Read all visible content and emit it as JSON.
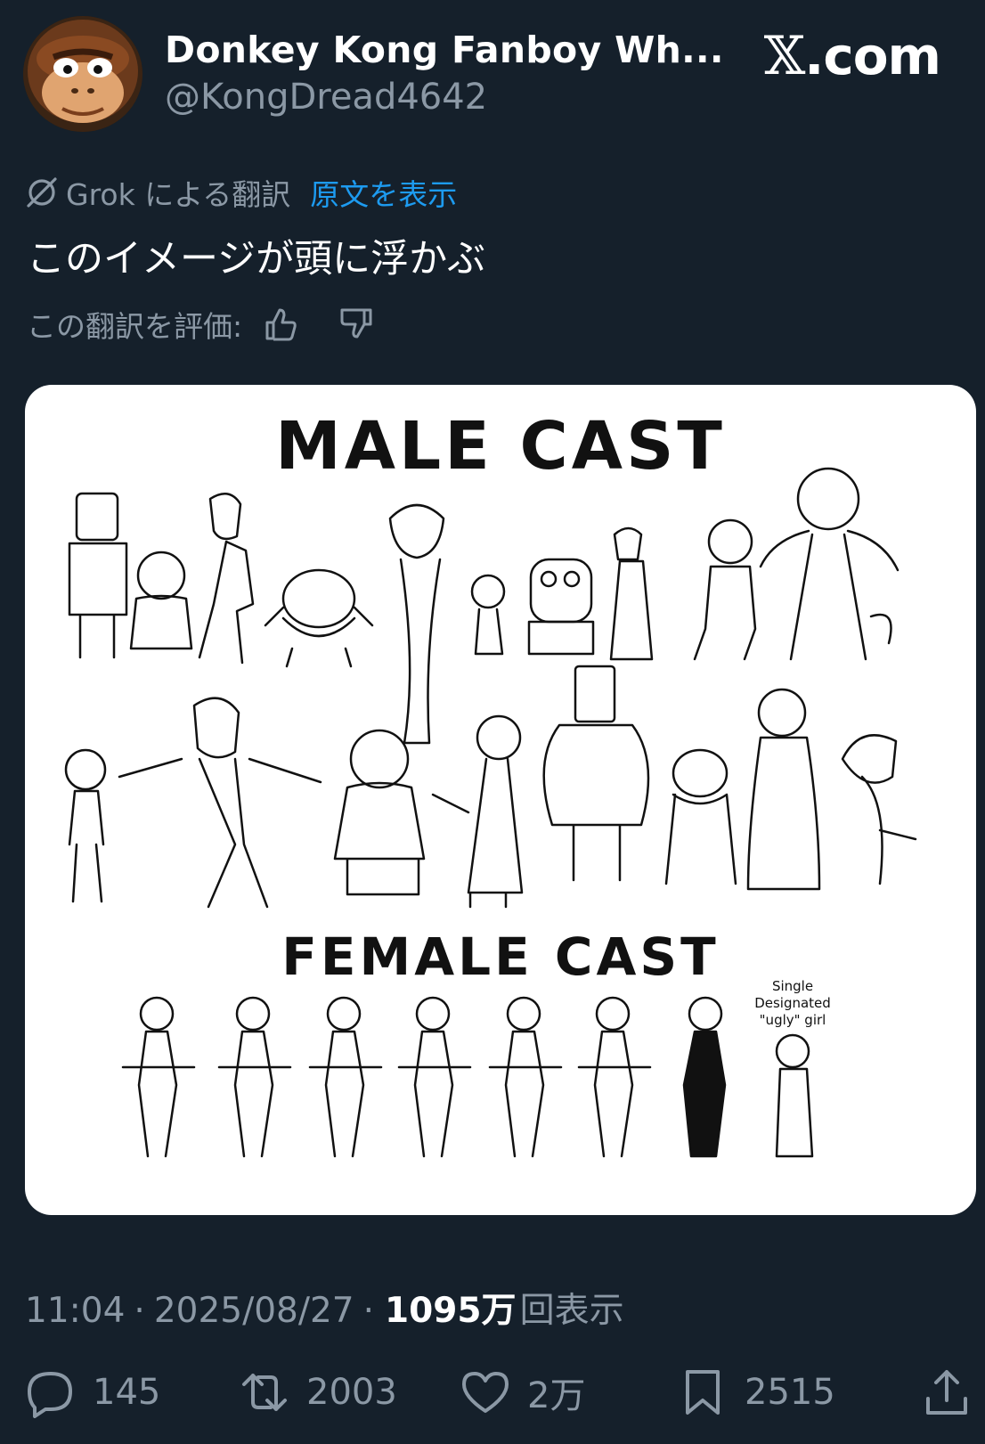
{
  "author": {
    "display_name": "Donkey Kong Fanboy Wh...",
    "handle": "@KongDread4642",
    "avatar_icon": "donkey-kong-avatar"
  },
  "brand": {
    "x_glyph": "𝕏",
    "suffix": ".com"
  },
  "translation": {
    "label": "Grok による翻訳",
    "show_original": "原文を表示",
    "text": "このイメージが頭に浮かぶ",
    "rate_label": "この翻訳を評価:"
  },
  "media": {
    "heading_male": "MALE CAST",
    "heading_female": "FEMALE CAST",
    "note_line1": "Single",
    "note_line2": "Designated",
    "note_line3": "\"ugly\" girl"
  },
  "meta": {
    "time": "11:04",
    "separator": "·",
    "date": "2025/08/27",
    "views_count": "1095万",
    "views_label": "回表示"
  },
  "actions": {
    "replies": "145",
    "reposts": "2003",
    "likes": "2万",
    "bookmarks": "2515"
  },
  "colors": {
    "background": "#15202b",
    "text": "#ffffff",
    "muted": "#8b98a5",
    "link": "#1d9bf0"
  }
}
